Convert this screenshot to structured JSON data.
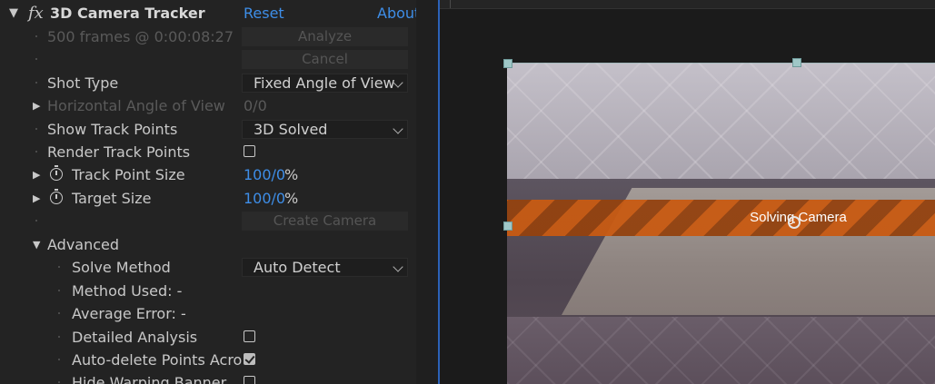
{
  "effect": {
    "title": "3D Camera Tracker",
    "reset_label": "Reset",
    "about_label": "About"
  },
  "rows": {
    "frames_status": "500 frames @ 0:00:08:27",
    "analyze_label": "Analyze",
    "cancel_label": "Cancel",
    "shot_type_label": "Shot Type",
    "shot_type_value": "Fixed Angle of View",
    "hfov_label": "Horizontal Angle of View",
    "hfov_value": "0/0",
    "show_track_points_label": "Show Track Points",
    "show_track_points_value": "3D Solved",
    "render_track_points_label": "Render Track Points",
    "track_point_size_label": "Track Point Size",
    "track_point_size_value": "100/0",
    "track_point_size_unit": "%",
    "target_size_label": "Target Size",
    "target_size_value": "100/0",
    "target_size_unit": "%",
    "create_camera_label": "Create Camera",
    "advanced_label": "Advanced",
    "solve_method_label": "Solve Method",
    "solve_method_value": "Auto Detect",
    "method_used_label": "Method Used: -",
    "average_error_label": "Average Error: -",
    "detailed_analysis_label": "Detailed Analysis",
    "auto_delete_label": "Auto-delete Points Acro",
    "hide_warping_label": "Hide Warping Banner"
  },
  "checkboxes": {
    "render_track_points": false,
    "detailed_analysis": false,
    "auto_delete": true,
    "hide_warping": false
  },
  "viewer": {
    "banner_text": "Solving Camera"
  },
  "colors": {
    "link": "#3e8ee8",
    "banner_stripe_a": "#c85a12",
    "banner_stripe_b": "#93420f",
    "panel_bg": "#232323",
    "selection_border": "#2c62b8"
  }
}
